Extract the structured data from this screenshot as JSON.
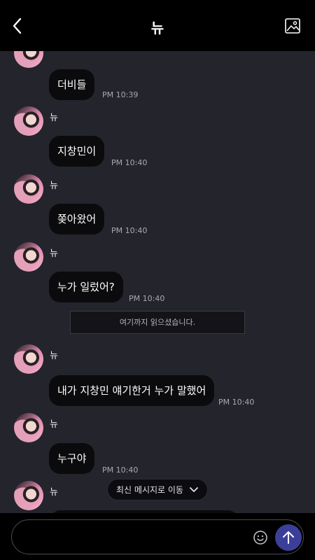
{
  "header": {
    "title": "뉴"
  },
  "messages": [
    {
      "sender": "",
      "text": "더비들",
      "time": "PM 10:39"
    },
    {
      "sender": "뉴",
      "text": "지창민이",
      "time": "PM 10:40"
    },
    {
      "sender": "뉴",
      "text": "쫒아왔어",
      "time": "PM 10:40"
    },
    {
      "sender": "뉴",
      "text": "누가 일렀어?",
      "time": "PM 10:40"
    },
    {
      "sender": "뉴",
      "text": "내가 지창민 얘기한거 누가 말했어",
      "time": "PM 10:40"
    },
    {
      "sender": "뉴",
      "text": "누구야",
      "time": "PM 10:40"
    },
    {
      "sender": "뉴"
    }
  ],
  "read_divider": "여기까지 읽으셨습니다.",
  "jump_latest": "최신 메시지로 이동",
  "composer": {
    "placeholder": "",
    "value": ""
  },
  "colors": {
    "accent": "#3c3f9a",
    "background": "#24242c",
    "bubble": "#0b0b0d"
  },
  "icons": [
    "back-icon",
    "gallery-icon",
    "chevron-down-icon",
    "emoji-icon",
    "send-arrow-icon"
  ]
}
